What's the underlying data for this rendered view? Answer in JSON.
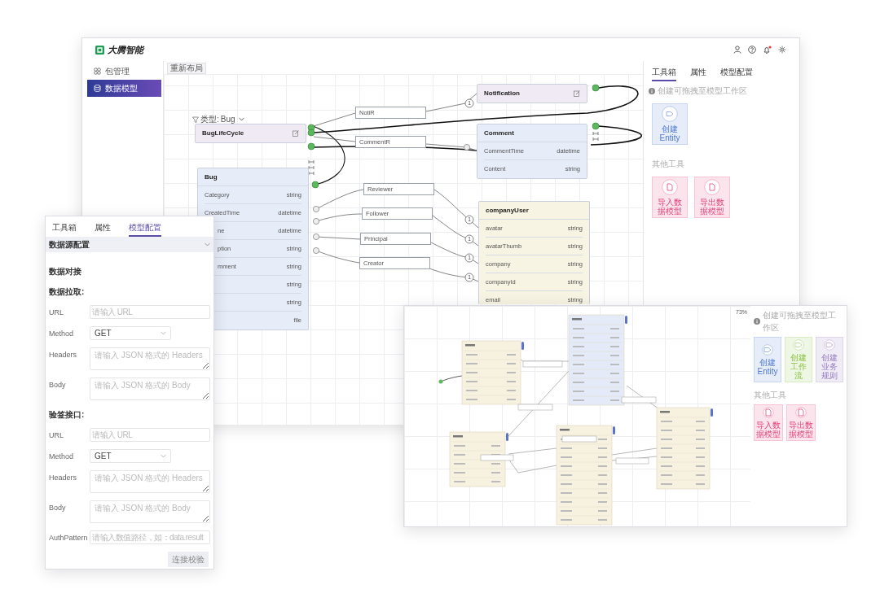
{
  "main_window": {
    "logo": "大腾智能",
    "unread_notifications": true,
    "sidebar": {
      "items": [
        {
          "label": "包管理",
          "selected": false
        },
        {
          "label": "数据模型",
          "selected": true
        }
      ]
    },
    "toolbar": {
      "relayout_button": "重新布局"
    },
    "canvas": {
      "filter": {
        "label": "类型:",
        "value": "Bug"
      },
      "entities": [
        {
          "name": "Notification",
          "color": "#efeaf3",
          "editable": true
        },
        {
          "name": "BugLifeCycle",
          "color": "#efeaf3",
          "editable": true
        },
        {
          "name": "Comment",
          "color": "#e6ecf8",
          "editable": false,
          "fields": [
            {
              "name": "CommentTime",
              "type": "datetime"
            },
            {
              "name": "Content",
              "type": "string"
            }
          ]
        },
        {
          "name": "Bug",
          "color": "#e6ecf8",
          "editable": false,
          "fields": [
            {
              "name": "Category",
              "type": "string"
            },
            {
              "name": "CreatedTime",
              "type": "datetime"
            },
            {
              "name": "ne",
              "type": "datetime"
            },
            {
              "name": "ption",
              "type": "string"
            },
            {
              "name": "mment",
              "type": "string"
            },
            {
              "type": "string"
            },
            {
              "type": "string"
            },
            {
              "type": "file"
            }
          ]
        },
        {
          "name": "companyUser",
          "color": "#f8f4e3",
          "editable": false,
          "fields": [
            {
              "name": "avatar",
              "type": "string"
            },
            {
              "name": "avatarThumb",
              "type": "string"
            },
            {
              "name": "company",
              "type": "string"
            },
            {
              "name": "companyId",
              "type": "string"
            },
            {
              "name": "email",
              "type": "string"
            }
          ]
        }
      ],
      "relations": [
        {
          "label": "NotiR"
        },
        {
          "label": "CommentR"
        },
        {
          "label": "Reviewer"
        },
        {
          "label": "Follower"
        },
        {
          "label": "Principal"
        },
        {
          "label": "Creator"
        }
      ],
      "badges": [
        "1",
        "1",
        "1",
        "1",
        "1"
      ]
    },
    "right_panel": {
      "tabs": [
        {
          "label": "工具箱",
          "selected": true
        },
        {
          "label": "属性",
          "selected": false
        },
        {
          "label": "模型配置",
          "selected": false
        }
      ],
      "hint": "创建可拖拽至模型工作区",
      "create_tools": [
        {
          "label": "创建 Entity",
          "color": "#e6ecf8"
        }
      ],
      "section_label": "其他工具",
      "data_tools": [
        {
          "label": "导入数据模型",
          "color": "#fbe4ec"
        },
        {
          "label": "导出数据模型",
          "color": "#fbe4ec"
        }
      ]
    }
  },
  "config_panel": {
    "tabs": [
      {
        "label": "工具箱",
        "selected": false
      },
      {
        "label": "属性",
        "selected": false
      },
      {
        "label": "模型配置",
        "selected": true
      }
    ],
    "section": {
      "title": "数据源配置",
      "expanded": true
    },
    "subtitle": "数据对接",
    "groups": [
      {
        "title": "数据拉取:",
        "fields": [
          {
            "label": "URL",
            "kind": "input",
            "placeholder": "请输入 URL"
          },
          {
            "label": "Method",
            "kind": "select",
            "value": "GET"
          },
          {
            "label": "Headers",
            "kind": "textarea",
            "placeholder": "请输入 JSON 格式的 Headers"
          },
          {
            "label": "Body",
            "kind": "textarea",
            "placeholder": "请输入 JSON 格式的 Body"
          }
        ]
      },
      {
        "title": "验签接口:",
        "fields": [
          {
            "label": "URL",
            "kind": "input",
            "placeholder": "请输入 URL"
          },
          {
            "label": "Method",
            "kind": "select",
            "value": "GET"
          },
          {
            "label": "Headers",
            "kind": "textarea",
            "placeholder": "请输入 JSON 格式的 Headers"
          },
          {
            "label": "Body",
            "kind": "textarea",
            "placeholder": "请输入 JSON 格式的 Body"
          },
          {
            "label": "AuthPattern",
            "kind": "input",
            "placeholder": "请输入数值路径，如：data.result"
          }
        ]
      }
    ],
    "button": "连接校验"
  },
  "overview_window": {
    "zoom": "73%",
    "hint": "创建可拖拽至模型工作区",
    "create_tools": [
      {
        "label": "创建 Entity",
        "color": "#e6ecf8"
      },
      {
        "label": "创建工作流",
        "color": "#eef6e4"
      },
      {
        "label": "创建业务规则",
        "color": "#f0ecf6"
      }
    ],
    "section_label": "其他工具",
    "data_tools": [
      {
        "label": "导入数据模型",
        "color": "#fbe4ec"
      },
      {
        "label": "导出数据模型",
        "color": "#fbe4ec"
      }
    ]
  }
}
